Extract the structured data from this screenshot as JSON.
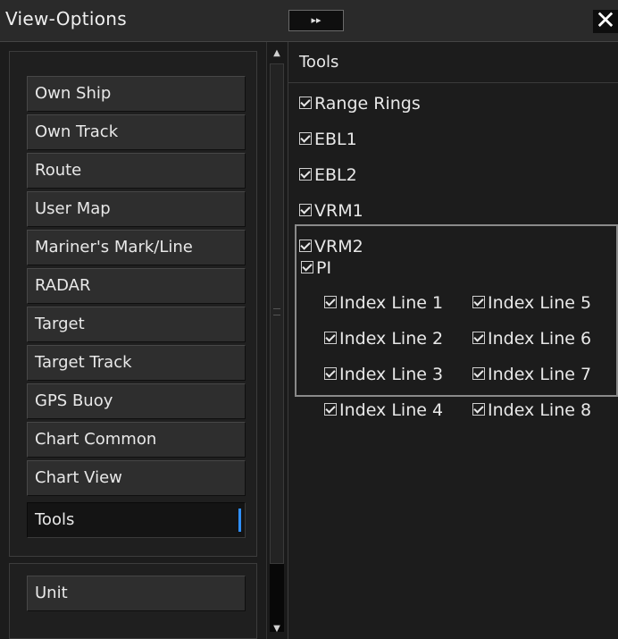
{
  "window": {
    "title": "View-Options",
    "collapse_label": "▸▸",
    "close_label": "✕"
  },
  "sidebar": {
    "items": [
      {
        "label": "Own Ship",
        "selected": false
      },
      {
        "label": "Own Track",
        "selected": false
      },
      {
        "label": "Route",
        "selected": false
      },
      {
        "label": "User Map",
        "selected": false
      },
      {
        "label": "Mariner's Mark/Line",
        "selected": false
      },
      {
        "label": "RADAR",
        "selected": false
      },
      {
        "label": "Target",
        "selected": false
      },
      {
        "label": "Target Track",
        "selected": false
      },
      {
        "label": "GPS Buoy",
        "selected": false
      },
      {
        "label": "Chart Common",
        "selected": false
      },
      {
        "label": "Chart View",
        "selected": false
      },
      {
        "label": "Tools",
        "selected": true
      }
    ],
    "unit_label": "Unit"
  },
  "scrollbar": {
    "up_icon": "▲",
    "down_icon": "▼"
  },
  "main": {
    "section_title": "Tools",
    "options": [
      {
        "label": "Range Rings",
        "checked": true
      },
      {
        "label": "EBL1",
        "checked": true
      },
      {
        "label": "EBL2",
        "checked": true
      },
      {
        "label": "VRM1",
        "checked": true
      },
      {
        "label": "VRM2",
        "checked": true
      }
    ],
    "pi": {
      "label": "PI",
      "checked": true,
      "index_lines": [
        {
          "label": "Index Line 1",
          "checked": true
        },
        {
          "label": "Index Line 2",
          "checked": true
        },
        {
          "label": "Index Line 3",
          "checked": true
        },
        {
          "label": "Index Line 4",
          "checked": true
        },
        {
          "label": "Index Line 5",
          "checked": true
        },
        {
          "label": "Index Line 6",
          "checked": true
        },
        {
          "label": "Index Line 7",
          "checked": true
        },
        {
          "label": "Index Line 8",
          "checked": true
        }
      ]
    }
  },
  "colors": {
    "accent": "#2f8fff",
    "background": "#1c1c1c"
  }
}
